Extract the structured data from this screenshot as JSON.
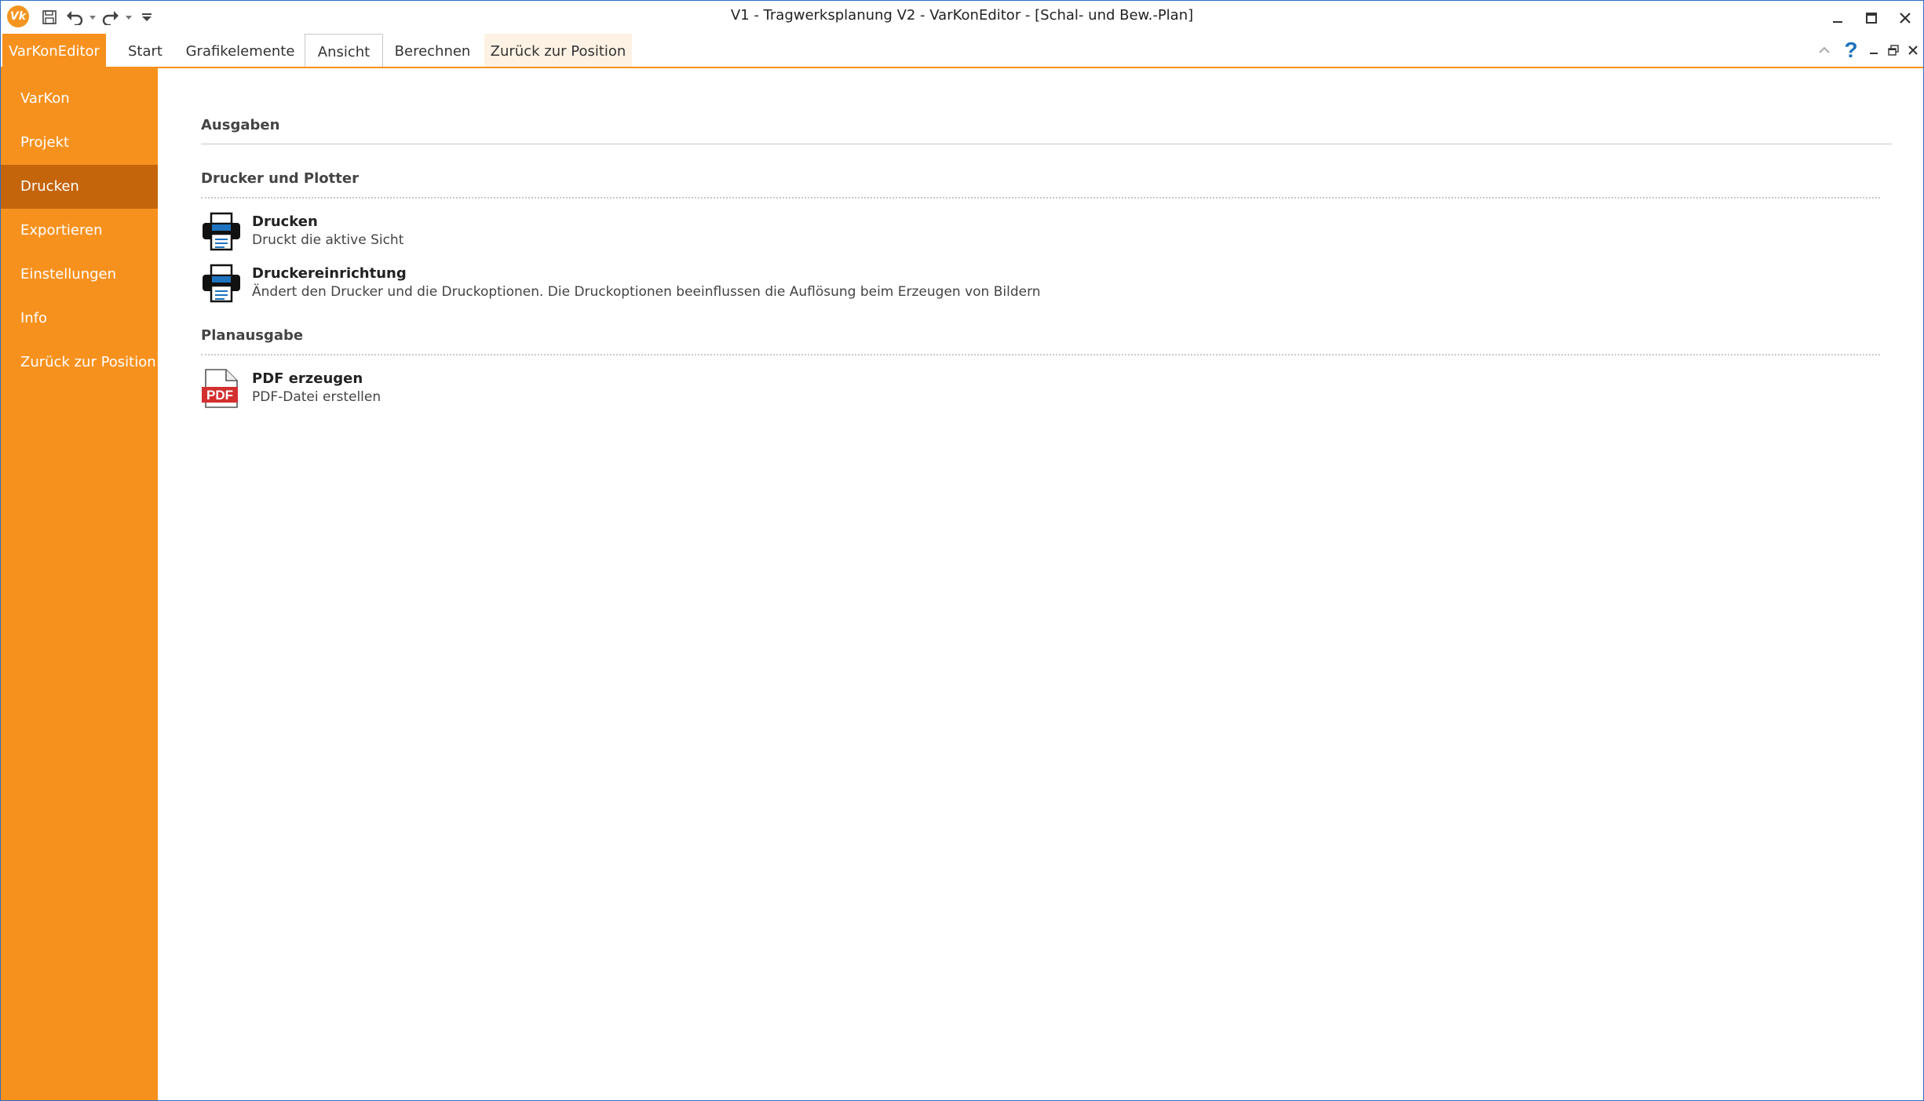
{
  "window": {
    "title": "V1 - Tragwerksplanung V2 - VarKonEditor - [Schal- und Bew.-Plan]",
    "logo_text": "Vk"
  },
  "quick_access": {
    "icons": [
      "save-icon",
      "undo-icon",
      "redo-icon",
      "customize-icon"
    ]
  },
  "ribbon": {
    "file_tab": "VarKonEditor",
    "tabs": [
      {
        "label": "Start"
      },
      {
        "label": "Grafikelemente"
      },
      {
        "label": "Ansicht"
      },
      {
        "label": "Berechnen"
      },
      {
        "label": "Zurück zur Position"
      }
    ],
    "help_label": "?"
  },
  "sidebar": {
    "items": [
      {
        "label": "VarKon"
      },
      {
        "label": "Projekt"
      },
      {
        "label": "Drucken"
      },
      {
        "label": "Exportieren"
      },
      {
        "label": "Einstellungen"
      },
      {
        "label": "Info"
      },
      {
        "label": "Zurück zur Position"
      }
    ],
    "selected": "Drucken"
  },
  "main": {
    "header": "Ausgaben",
    "groups": [
      {
        "title": "Drucker und Plotter",
        "commands": [
          {
            "title": "Drucken",
            "description": "Druckt die aktive Sicht",
            "icon": "printer-icon"
          },
          {
            "title": "Druckereinrichtung",
            "description": "Ändert den Drucker und die Druckoptionen. Die Druckoptionen beeinflussen die Auflösung beim Erzeugen von Bildern",
            "icon": "printer-setup-icon"
          }
        ]
      },
      {
        "title": "Planausgabe",
        "commands": [
          {
            "title": "PDF erzeugen",
            "description": "PDF-Datei erstellen",
            "icon": "pdf-icon",
            "icon_text": "PDF"
          }
        ]
      }
    ]
  },
  "colors": {
    "accent": "#f7911e",
    "selected": "#c4650c",
    "pdf_red": "#d32f2f",
    "printer_blue": "#1e73be"
  }
}
